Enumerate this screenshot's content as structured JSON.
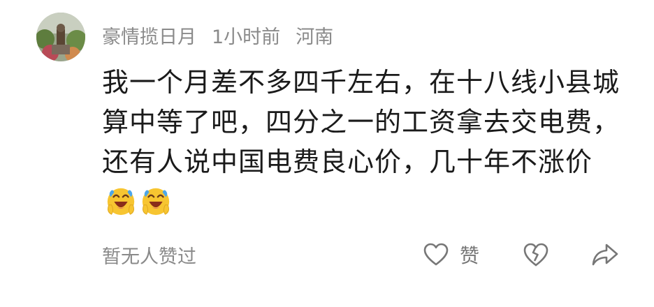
{
  "comment": {
    "username": "豪情揽日月",
    "time": "1小时前",
    "location": "河南",
    "content": "我一个月差不多四千左右，在十八线小县城算中等了吧，四分之一的工资拿去交电费，还有人说中国电费良心价，几十年不涨价",
    "emojis": [
      "laughing-crying-emoji",
      "laughing-crying-emoji"
    ],
    "likes_text": "暂无人赞过",
    "like_label": "赞",
    "icons": {
      "like": "heart-icon",
      "dislike": "broken-heart-icon",
      "share": "share-arrow-icon"
    },
    "colors": {
      "meta": "#8a8a8a",
      "text": "#1a1a1a",
      "icon": "#777777",
      "emoji_face": "#f7c531",
      "emoji_tears": "#4da6e8"
    }
  }
}
